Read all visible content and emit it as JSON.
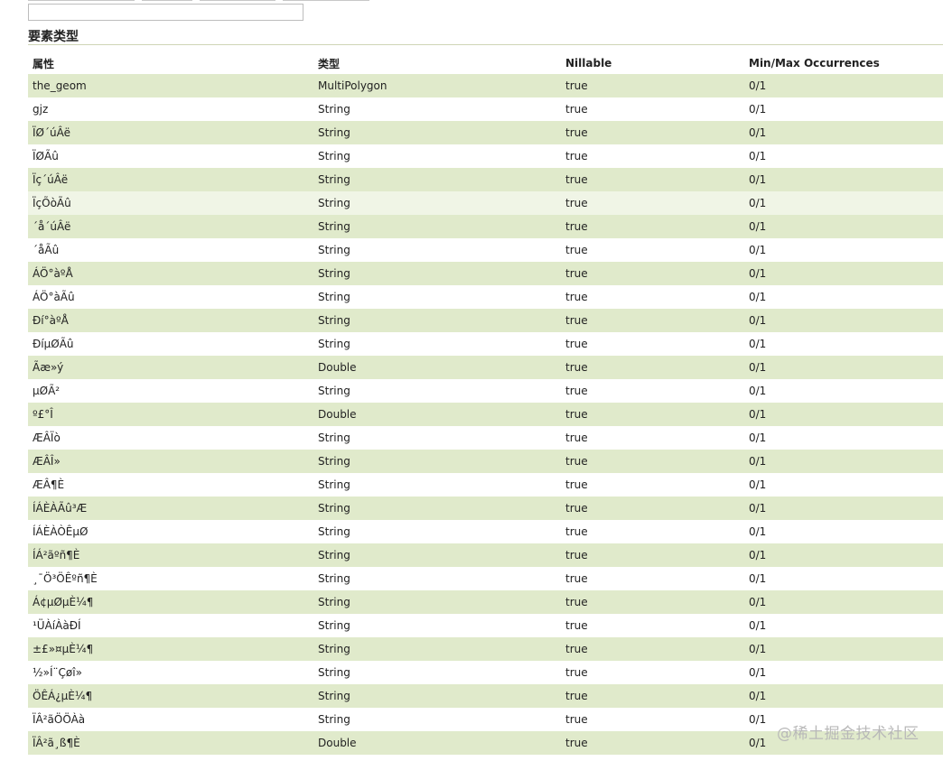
{
  "search": {
    "value": "",
    "placeholder": ""
  },
  "section": {
    "title": "要素类型"
  },
  "table": {
    "headers": [
      "属性",
      "类型",
      "Nillable",
      "Min/Max Occurrences"
    ],
    "rows": [
      [
        "the_geom",
        "MultiPolygon",
        "true",
        "0/1"
      ],
      [
        "gjz",
        "String",
        "true",
        "0/1"
      ],
      [
        "ÏØ´úÂë",
        "String",
        "true",
        "0/1"
      ],
      [
        "ÏØÃû",
        "String",
        "true",
        "0/1"
      ],
      [
        "Ïç´úÂë",
        "String",
        "true",
        "0/1"
      ],
      [
        "ÏçÕòÃû",
        "String",
        "true",
        "0/1"
      ],
      [
        "´å´úÂë",
        "String",
        "true",
        "0/1"
      ],
      [
        "´åÃû",
        "String",
        "true",
        "0/1"
      ],
      [
        "ÁÖ°àºÅ",
        "String",
        "true",
        "0/1"
      ],
      [
        "ÁÖ°àÃû",
        "String",
        "true",
        "0/1"
      ],
      [
        "Ðí°àºÅ",
        "String",
        "true",
        "0/1"
      ],
      [
        "ÐíµØÃû",
        "String",
        "true",
        "0/1"
      ],
      [
        "Ãæ»ý",
        "Double",
        "true",
        "0/1"
      ],
      [
        "µØÃ²",
        "String",
        "true",
        "0/1"
      ],
      [
        "º£°Î",
        "Double",
        "true",
        "0/1"
      ],
      [
        "ÆÂÏò",
        "String",
        "true",
        "0/1"
      ],
      [
        "ÆÂÎ»",
        "String",
        "true",
        "0/1"
      ],
      [
        "ÆÂ¶È",
        "String",
        "true",
        "0/1"
      ],
      [
        "ÍÁÈÀÃû³Æ",
        "String",
        "true",
        "0/1"
      ],
      [
        "ÍÁÈÀÒÊµØ",
        "String",
        "true",
        "0/1"
      ],
      [
        "ÍÁ²ãºñ¶È",
        "String",
        "true",
        "0/1"
      ],
      [
        "¸¯Ö³ÖÊºñ¶È",
        "String",
        "true",
        "0/1"
      ],
      [
        "Á¢µØµÈ¼¶",
        "String",
        "true",
        "0/1"
      ],
      [
        "¹ÜÀíÀàÐÍ",
        "String",
        "true",
        "0/1"
      ],
      [
        "±£»¤µÈ¼¶",
        "String",
        "true",
        "0/1"
      ],
      [
        "½»Í¨Çøî»",
        "String",
        "true",
        "0/1"
      ],
      [
        "ÖÊÁ¿µÈ¼¶",
        "String",
        "true",
        "0/1"
      ],
      [
        "ÏÂ²ãÖÖÀà",
        "String",
        "true",
        "0/1"
      ],
      [
        "ÏÂ²ã¸ß¶È",
        "Double",
        "true",
        "0/1"
      ]
    ],
    "hovered_row_index": 5
  },
  "watermark": {
    "text": "@稀土掘金技术社区"
  },
  "colors": {
    "row_striped": "#e0eacb",
    "row_plain": "#ffffff",
    "row_hover": "#f0f5e6",
    "rule": "#cfd5b6"
  }
}
